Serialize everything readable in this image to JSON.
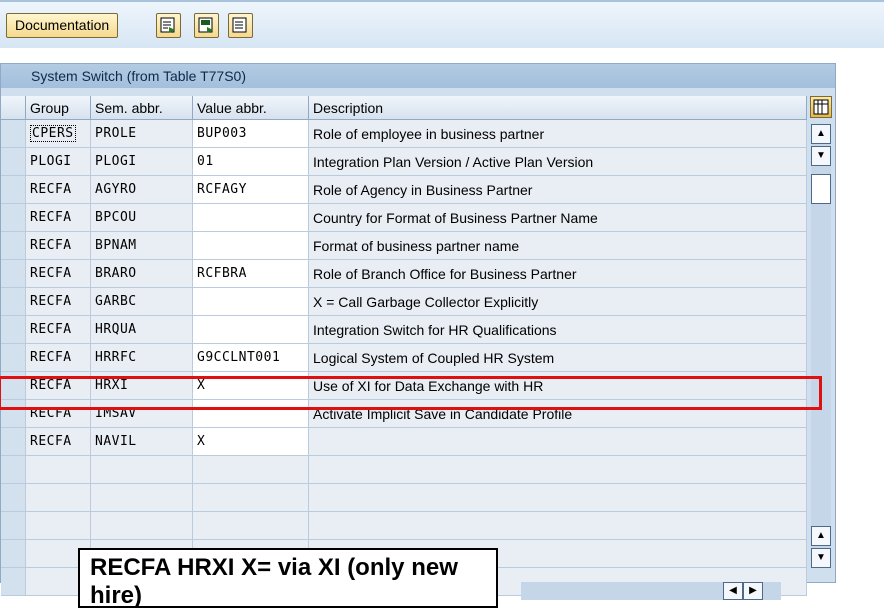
{
  "toolbar": {
    "documentation_label": "Documentation",
    "icons": [
      "export-icon",
      "export-icon",
      "export-icon"
    ]
  },
  "table": {
    "title": "System Switch (from Table T77S0)",
    "columns": [
      "Group",
      "Sem. abbr.",
      "Value abbr.",
      "Description"
    ],
    "rows": [
      {
        "group": "CPERS",
        "sem": "PROLE",
        "value": "BUP003",
        "desc": "Role of employee in business partner"
      },
      {
        "group": "PLOGI",
        "sem": "PLOGI",
        "value": "01",
        "desc": "Integration Plan Version / Active Plan Version"
      },
      {
        "group": "RECFA",
        "sem": "AGYRO",
        "value": "RCFAGY",
        "desc": "Role of Agency in Business Partner"
      },
      {
        "group": "RECFA",
        "sem": "BPCOU",
        "value": "",
        "desc": "Country for Format of Business Partner Name"
      },
      {
        "group": "RECFA",
        "sem": "BPNAM",
        "value": "",
        "desc": "Format of business partner name"
      },
      {
        "group": "RECFA",
        "sem": "BRARO",
        "value": "RCFBRA",
        "desc": "Role of Branch Office for Business Partner"
      },
      {
        "group": "RECFA",
        "sem": "GARBC",
        "value": "",
        "desc": "X = Call Garbage Collector Explicitly"
      },
      {
        "group": "RECFA",
        "sem": "HRQUA",
        "value": "",
        "desc": "Integration Switch for HR Qualifications"
      },
      {
        "group": "RECFA",
        "sem": "HRRFC",
        "value": "G9CCLNT001",
        "desc": "Logical System of Coupled HR System"
      },
      {
        "group": "RECFA",
        "sem": "HRXI",
        "value": "X",
        "desc": "Use of XI for Data Exchange with HR"
      },
      {
        "group": "RECFA",
        "sem": "IMSAV",
        "value": "",
        "desc": "Activate Implicit Save in Candidate Profile"
      },
      {
        "group": "RECFA",
        "sem": "NAVIL",
        "value": "X",
        "desc": ""
      }
    ]
  },
  "callout": {
    "line1": "RECFA HRXI X= via XI (only new hire)"
  },
  "colors": {
    "highlight": "#e01010",
    "toolbar_button": "#f5d98e",
    "table_bg": "#cfdfee"
  }
}
